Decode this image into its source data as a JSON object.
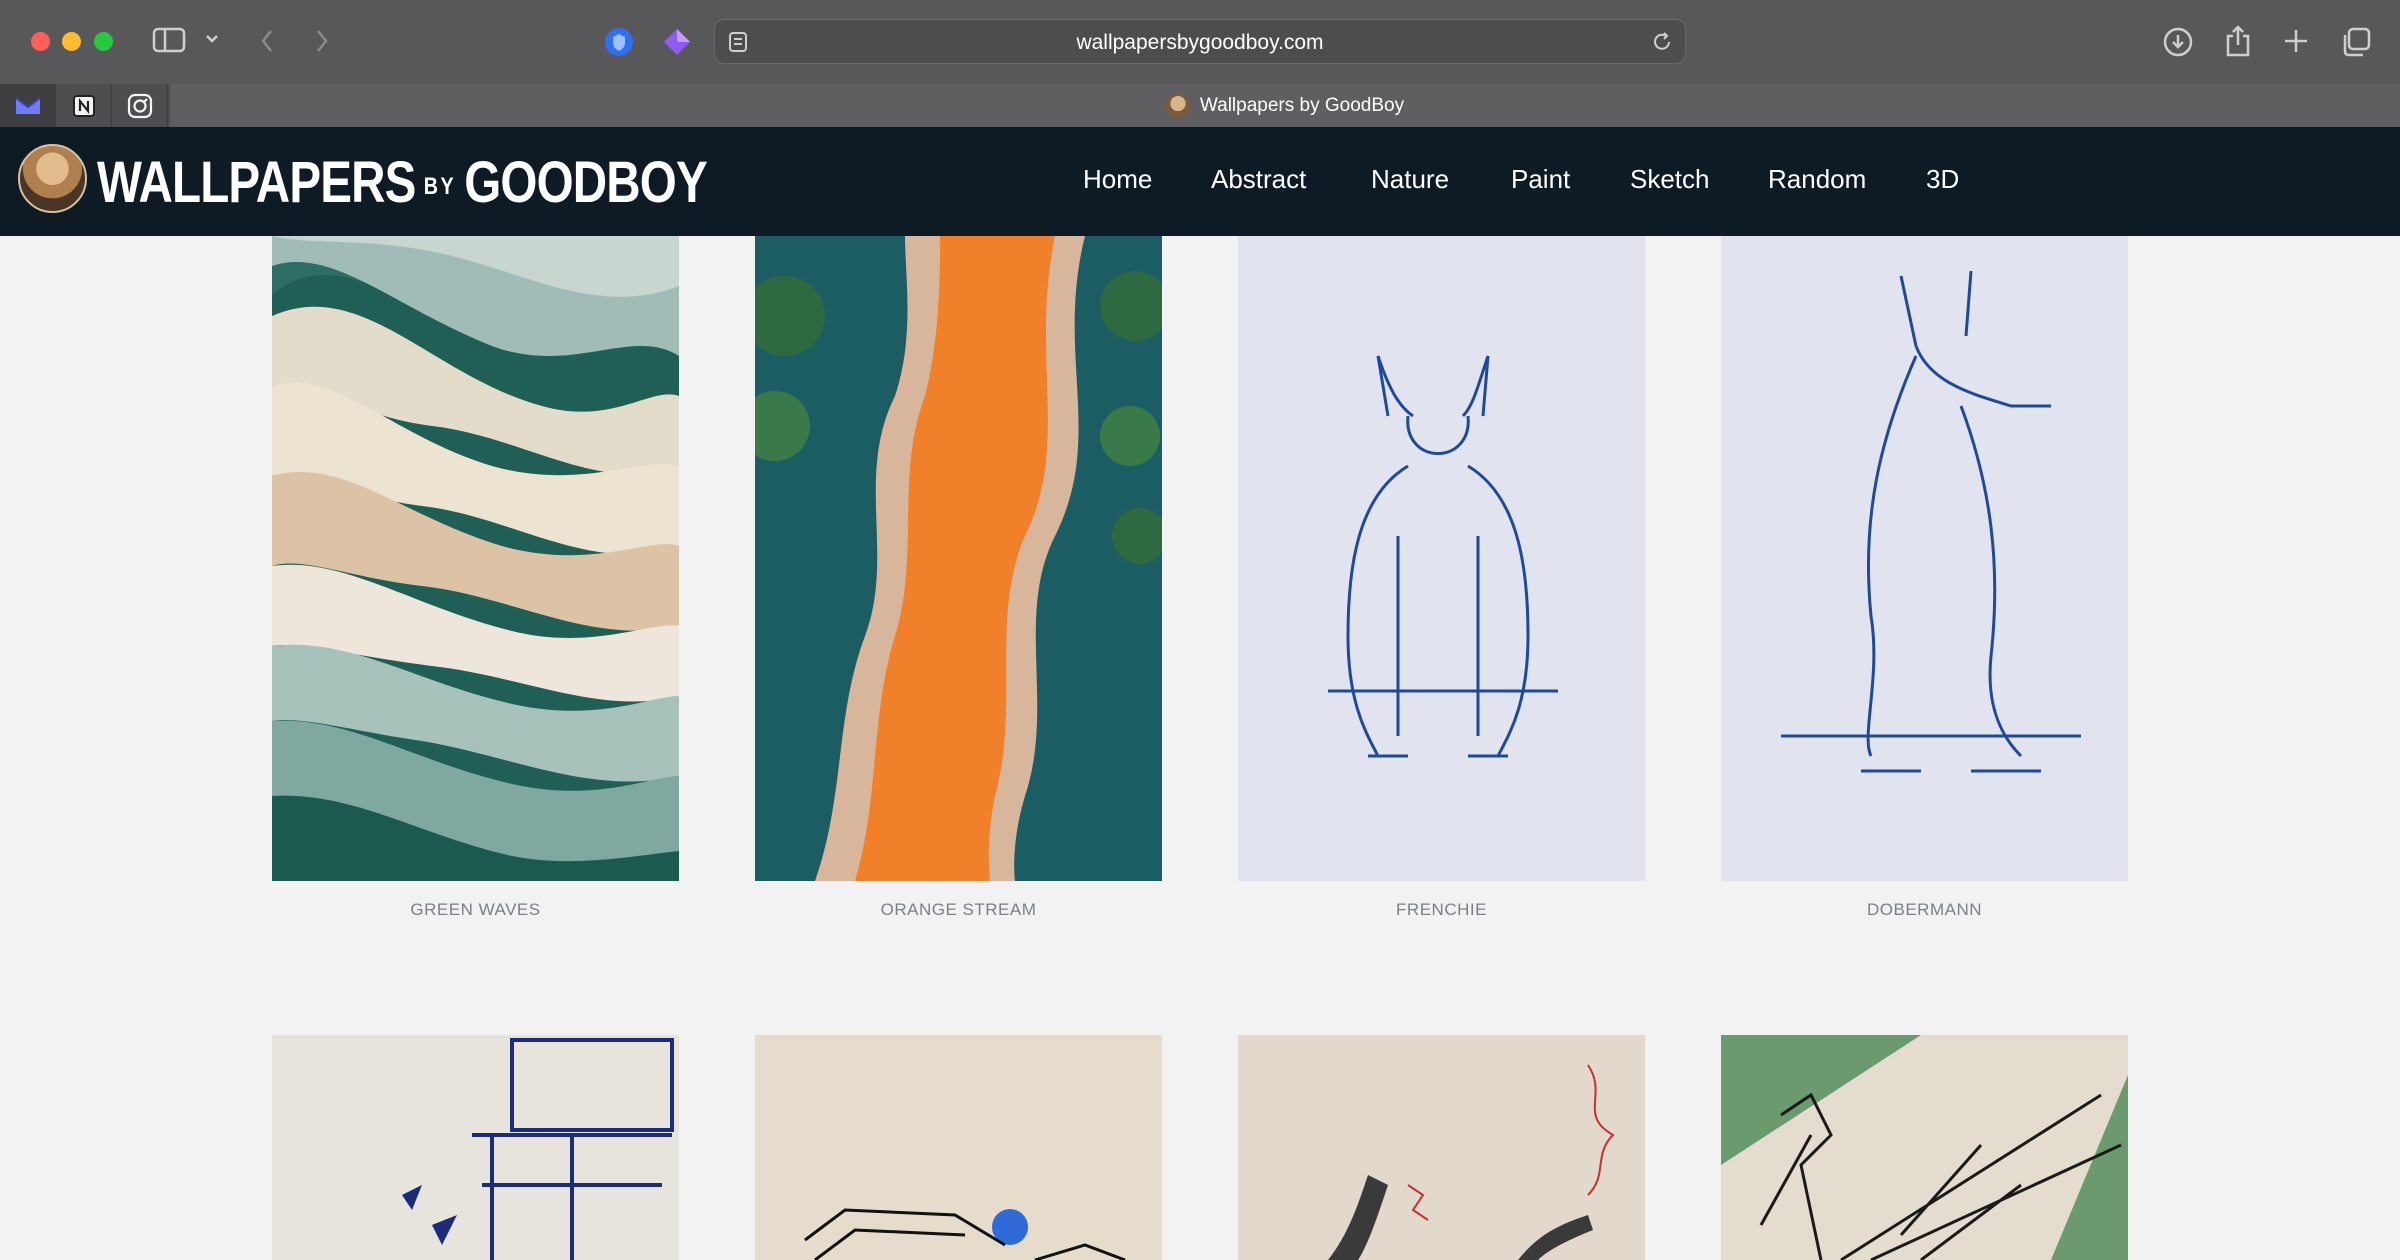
{
  "browser": {
    "url": "wallpapersbygoodboy.com",
    "active_tab_title": "Wallpapers by GoodBoy"
  },
  "site": {
    "logo_main": "WALLPAPERS",
    "logo_by": "BY",
    "logo_brand": "GOODBOY",
    "nav": [
      "Home",
      "Abstract",
      "Nature",
      "Paint",
      "Sketch",
      "Random",
      "3D"
    ]
  },
  "gallery": {
    "row1": [
      {
        "caption": "GREEN WAVES"
      },
      {
        "caption": "ORANGE STREAM"
      },
      {
        "caption": "FRENCHIE"
      },
      {
        "caption": "DOBERMANN"
      }
    ]
  }
}
